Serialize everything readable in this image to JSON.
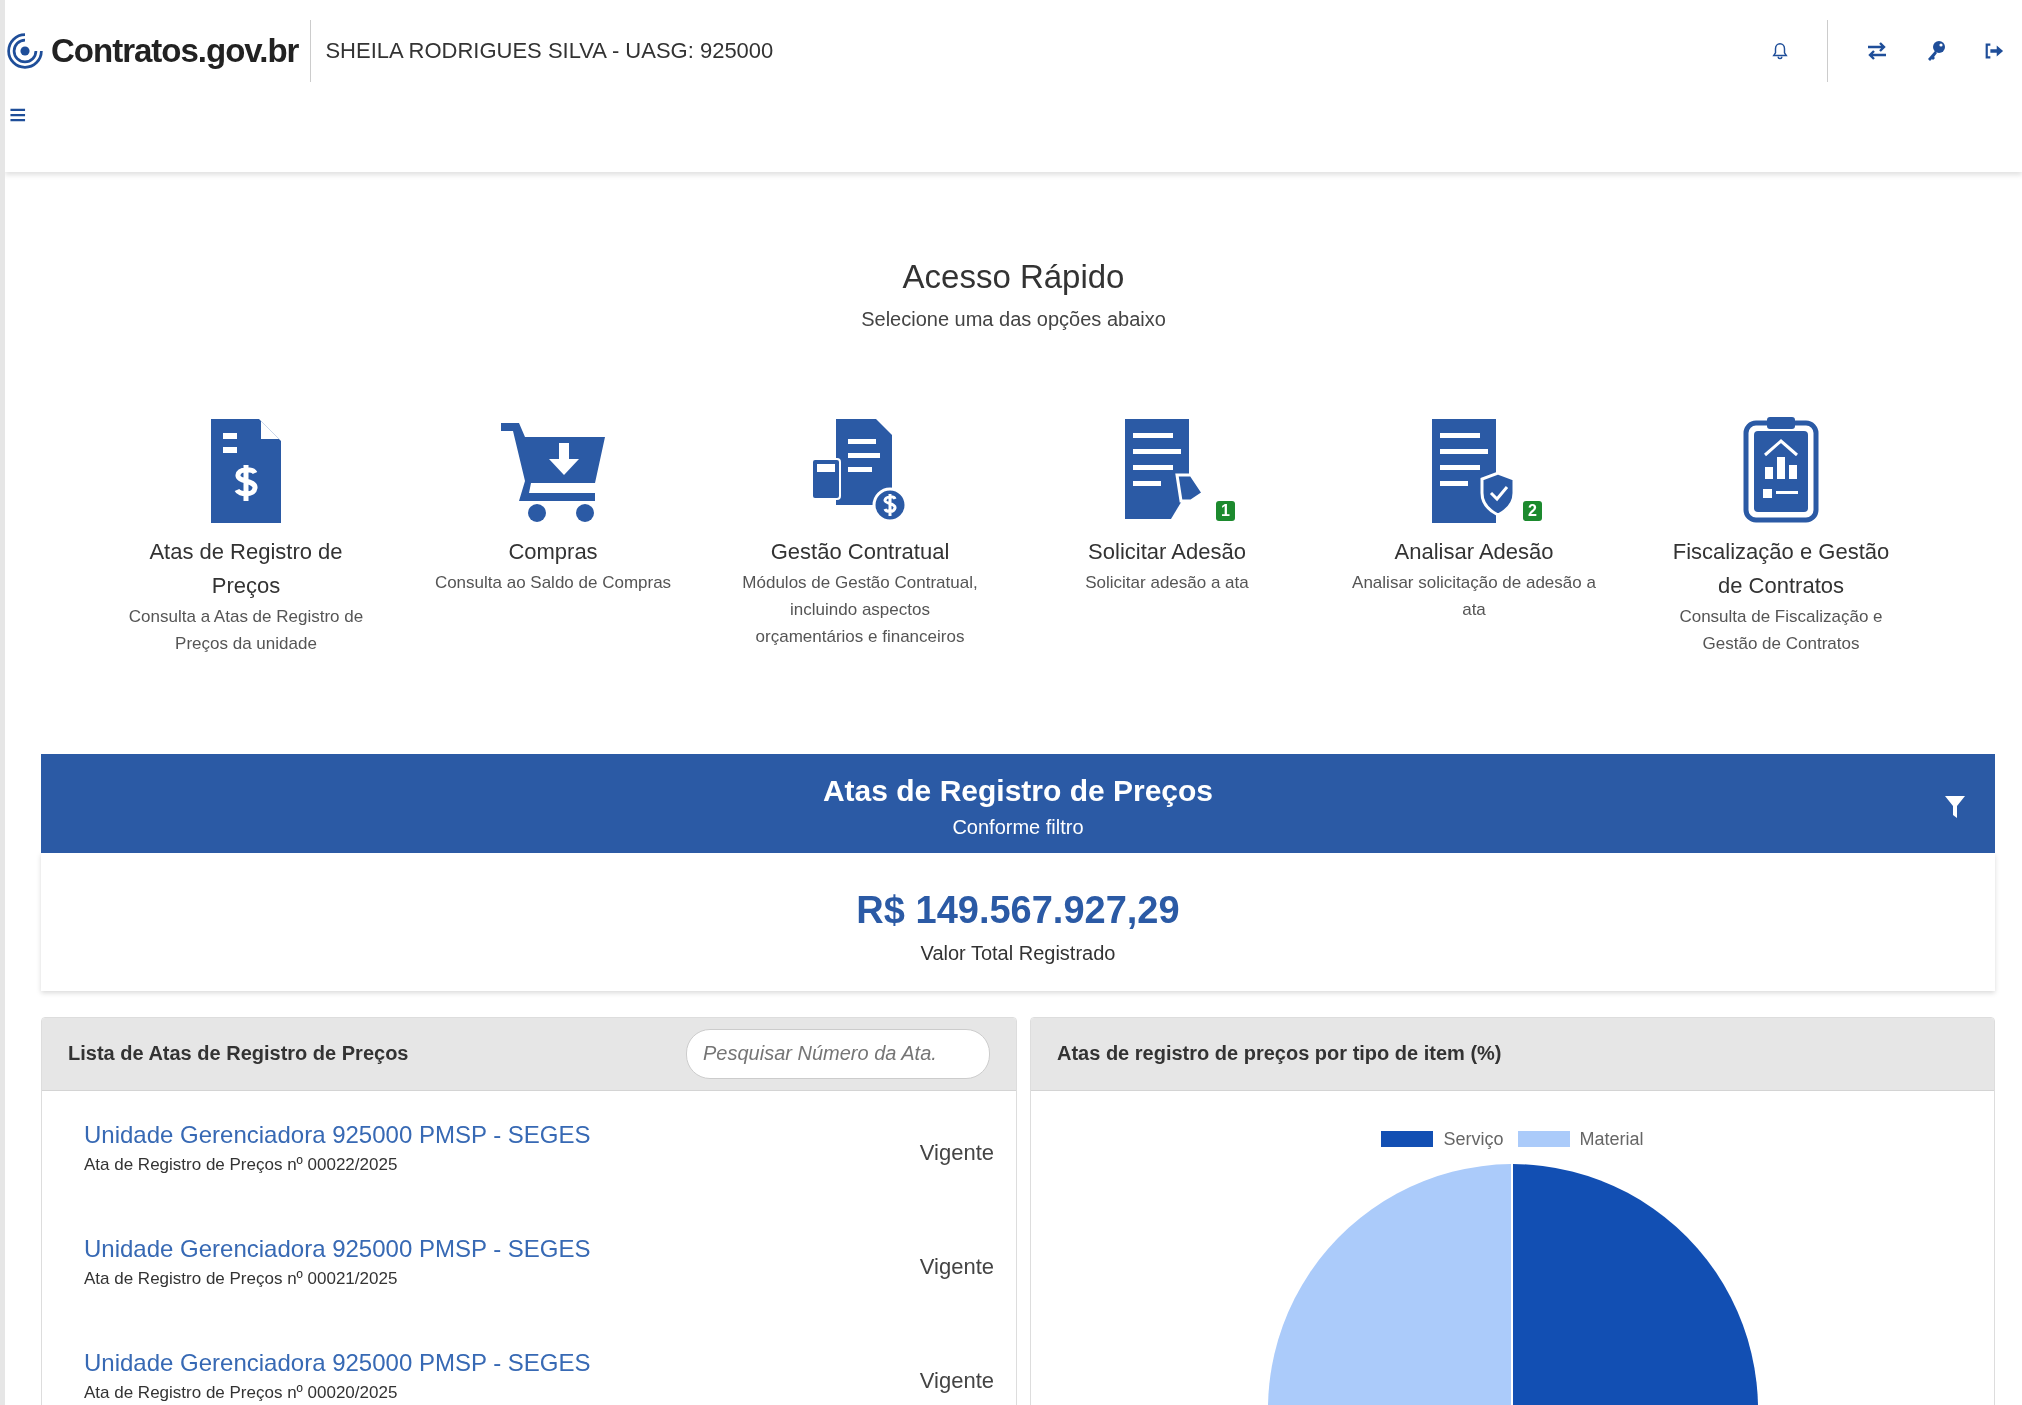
{
  "header": {
    "logo": "Contratos.gov.br",
    "user": "SHEILA RODRIGUES SILVA - UASG: 925000",
    "menu_glyph": "≡"
  },
  "quick_access": {
    "title": "Acesso Rápido",
    "subtitle": "Selecione uma das opções abaixo",
    "items": [
      {
        "label": "Atas de Registro de Preços",
        "description": "Consulta a Atas de Registro de Preços da unidade"
      },
      {
        "label": "Compras",
        "description": "Consulta ao Saldo de Compras"
      },
      {
        "label": "Gestão Contratual",
        "description": "Módulos de Gestão Contratual, incluindo aspectos orçamentários e financeiros"
      },
      {
        "label": "Solicitar Adesão",
        "description": "Solicitar adesão a ata",
        "badge": "1"
      },
      {
        "label": "Analisar Adesão",
        "description": "Analisar solicitação de adesão a ata",
        "badge": "2"
      },
      {
        "label": "Fiscalização e Gestão de Contratos",
        "description": "Consulta de Fiscalização e Gestão de Contratos"
      }
    ]
  },
  "summary": {
    "title": "Atas de Registro de Preços",
    "subtitle": "Conforme filtro",
    "value": "R$ 149.567.927,29",
    "value_label": "Valor Total Registrado"
  },
  "list_panel": {
    "title": "Lista de Atas de Registro de Preços",
    "search": {
      "placeholder": "Pesquisar Número da Ata."
    },
    "rows": [
      {
        "title": "Unidade Gerenciadora 925000 PMSP - SEGES",
        "subtitle": "Ata de Registro de Preços nº 00022/2025",
        "status": "Vigente"
      },
      {
        "title": "Unidade Gerenciadora 925000 PMSP - SEGES",
        "subtitle": "Ata de Registro de Preços nº 00021/2025",
        "status": "Vigente"
      },
      {
        "title": "Unidade Gerenciadora 925000 PMSP - SEGES",
        "subtitle": "Ata de Registro de Preços nº 00020/2025",
        "status": "Vigente"
      }
    ]
  },
  "chart_panel": {
    "title": "Atas de registro de preços por tipo de item (%)",
    "legend": [
      {
        "label": "Serviço",
        "color": "#124fb3"
      },
      {
        "label": "Material",
        "color": "#abcbfa"
      }
    ]
  }
}
